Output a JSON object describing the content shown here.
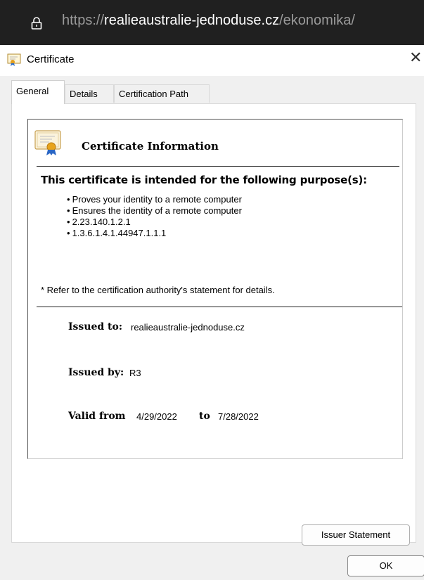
{
  "browser": {
    "url_scheme": "https://",
    "url_host": "realieaustralie-jednoduse.cz",
    "url_path": "/ekonomika/",
    "lock_icon": "lock-icon"
  },
  "dialog": {
    "title": "Certificate",
    "close_glyph": "✕",
    "tabs": [
      {
        "label": "General",
        "active": true
      },
      {
        "label": "Details",
        "active": false
      },
      {
        "label": "Certification Path",
        "active": false
      }
    ],
    "info": {
      "title": "Certificate Information",
      "purpose_heading": "This certificate is intended for the following purpose(s):",
      "purposes": [
        "Proves your identity to a remote computer",
        "Ensures the identity of a remote computer",
        "2.23.140.1.2.1",
        "1.3.6.1.4.1.44947.1.1.1"
      ],
      "footnote": "* Refer to the certification authority's statement for details.",
      "issued_to_label": "Issued to:",
      "issued_to": "realieaustralie-jednoduse.cz",
      "issued_by_label": "Issued by:",
      "issued_by": "R3",
      "valid_from_label": "Valid from",
      "valid_from": "4/29/2022",
      "valid_to_label": "to",
      "valid_to": "7/28/2022"
    },
    "issuer_statement_button": "Issuer Statement",
    "ok_button": "OK"
  },
  "colors": {
    "urlbar_bg": "#202020",
    "dialog_bg": "#f0f0f0",
    "panel_bg": "#ffffff"
  }
}
